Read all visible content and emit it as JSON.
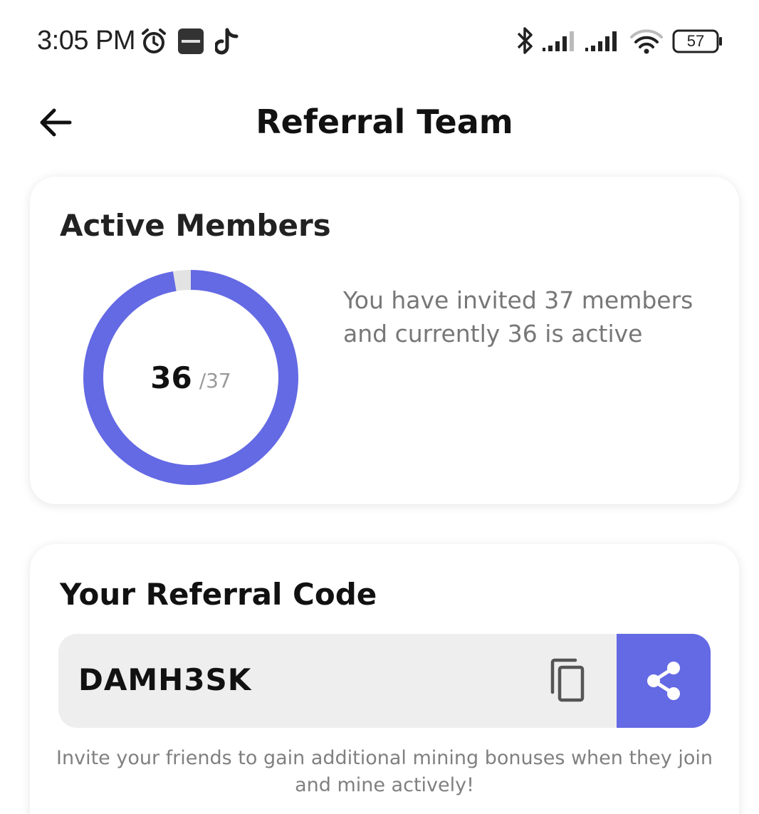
{
  "status_bar": {
    "time": "3:05 PM",
    "battery": "57",
    "icons": [
      "alarm-icon",
      "paytm-icon",
      "tiktok-icon",
      "bluetooth-icon",
      "signal-icon",
      "signal-icon",
      "wifi-icon",
      "battery-icon"
    ]
  },
  "header": {
    "title": "Referral Team",
    "back_icon": "arrow-left-icon"
  },
  "active_members": {
    "title": "Active Members",
    "active": "36",
    "total_label": "/37",
    "description": "You have invited 37 members and currently 36 is active",
    "progress_fraction": 0.973,
    "colors": {
      "active": "#6469e4",
      "inactive": "#e3e3e3"
    }
  },
  "referral": {
    "title": "Your Referral Code",
    "code": "DAMH3SK",
    "copy_icon": "copy-icon",
    "share_icon": "share-icon",
    "invite_text": "Invite your friends to gain additional mining bonuses when they join and mine actively!"
  },
  "colors": {
    "accent": "#6469e4"
  }
}
